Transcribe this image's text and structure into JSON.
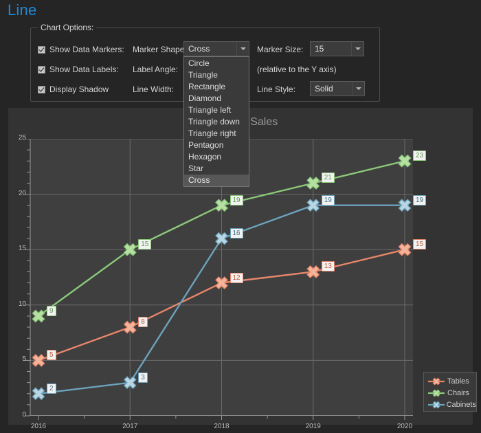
{
  "page": {
    "title": "Line",
    "title_color": "#1f8ad6"
  },
  "options": {
    "legend": "Chart Options:",
    "checkboxes": [
      {
        "label": "Show Data Markers:",
        "checked": true
      },
      {
        "label": "Show Data Labels:",
        "checked": true
      },
      {
        "label": "Display Shadow",
        "checked": true
      }
    ],
    "fields": [
      {
        "label": "Marker Shape:",
        "value": "Cross"
      },
      {
        "label": "Label Angle:",
        "value": ""
      },
      {
        "label": "Line Width:",
        "value": ""
      }
    ],
    "marker_size": {
      "label": "Marker Size:",
      "value": "15"
    },
    "marker_size_note": "(relative to the Y axis)",
    "line_style": {
      "label": "Line Style:",
      "value": "Solid"
    },
    "shape_options": [
      "Circle",
      "Triangle",
      "Rectangle",
      "Diamond",
      "Triangle left",
      "Triangle down",
      "Triangle right",
      "Pentagon",
      "Hexagon",
      "Star",
      "Cross"
    ],
    "shape_selected": "Cross"
  },
  "chart_data": {
    "type": "line",
    "title": "Furniture Sales",
    "xlabel": "",
    "ylabel": "",
    "categories": [
      "2016",
      "2017",
      "2018",
      "2019",
      "2020"
    ],
    "ylim": [
      0,
      25
    ],
    "yticks": [
      0,
      5,
      10,
      15,
      20,
      25
    ],
    "minor_tick_step": 1,
    "grid": true,
    "legend_position": "right",
    "marker": "cross",
    "line_style": "solid",
    "series": [
      {
        "name": "Tables",
        "color": "#e8866b",
        "marker_color": "#f3b49a",
        "label_border": "#e8866b",
        "label_text": "#c05a38",
        "values": [
          5,
          8,
          12,
          13,
          15
        ]
      },
      {
        "name": "Chairs",
        "color": "#8cc97a",
        "marker_color": "#b5e0a2",
        "label_border": "#8cc97a",
        "label_text": "#5f9a4e",
        "values": [
          9,
          15,
          19,
          21,
          23
        ]
      },
      {
        "name": "Cabinets",
        "color": "#6ca3bd",
        "marker_color": "#b9d6e4",
        "label_border": "#6ca3bd",
        "label_text": "#3d6f8c",
        "values": [
          2,
          3,
          16,
          19,
          19
        ]
      }
    ]
  },
  "legend": {
    "entries": [
      "Tables",
      "Chairs",
      "Cabinets"
    ]
  }
}
